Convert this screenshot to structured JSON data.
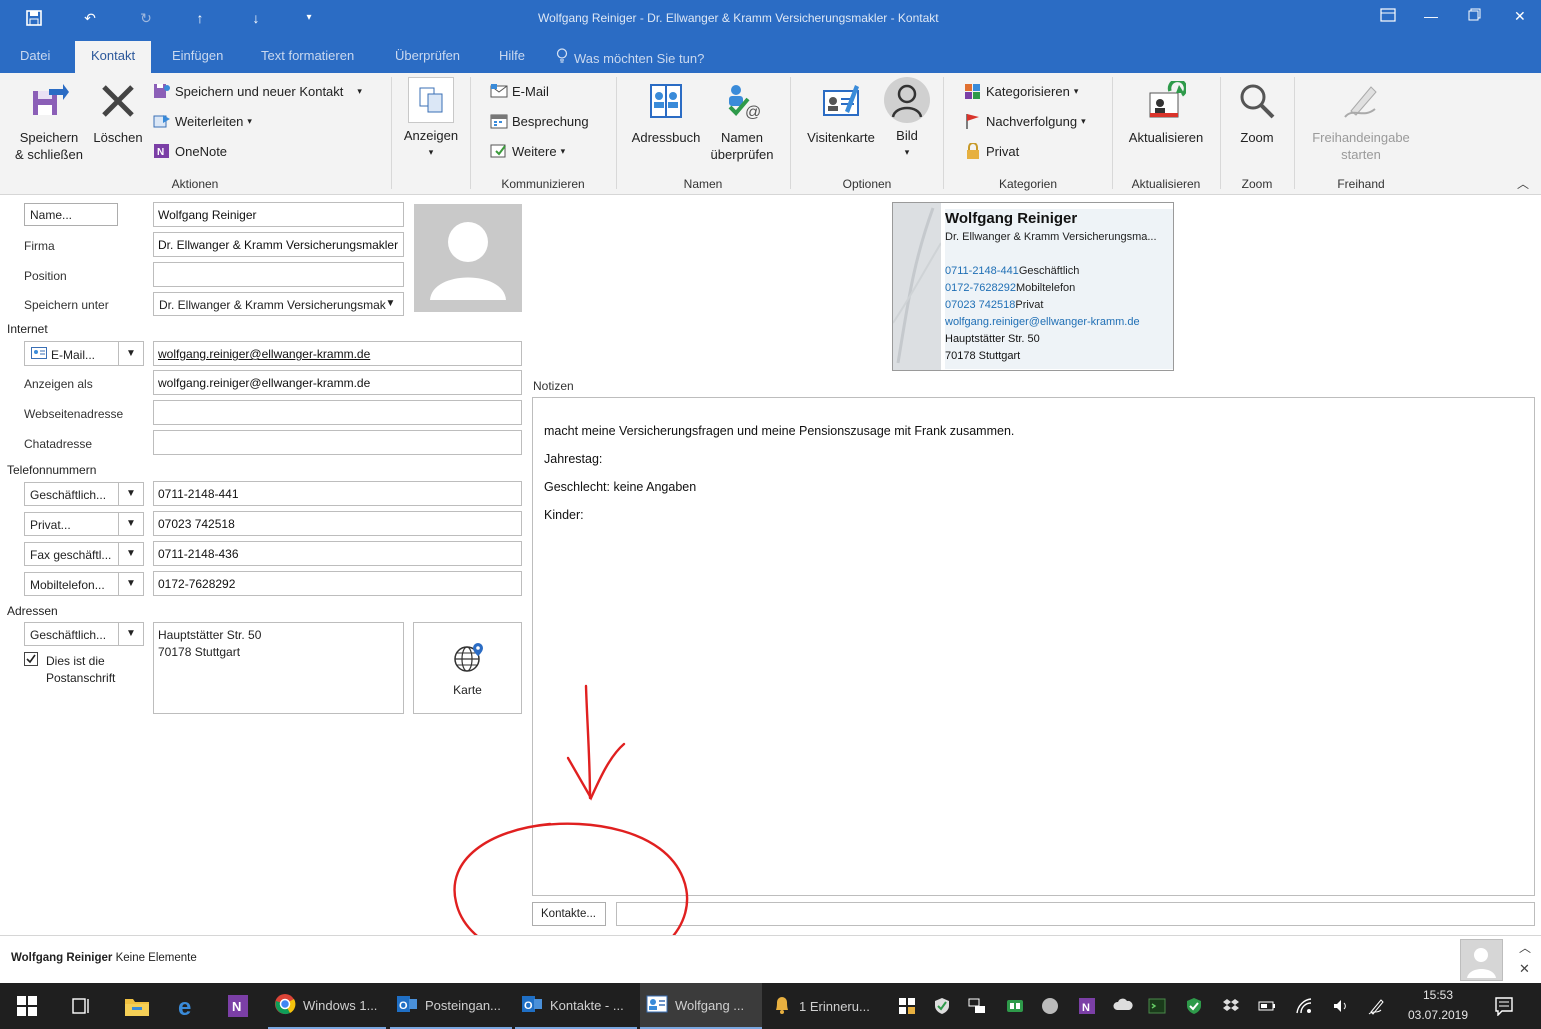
{
  "window": {
    "title": "Wolfgang Reiniger - Dr. Ellwanger & Kramm  Versicherungsmakler  -  Kontakt",
    "quick_access": [
      "save-icon",
      "undo-icon",
      "redo-icon",
      "up-arrow-icon",
      "down-arrow-icon",
      "customize-icon"
    ],
    "controls": [
      "restore-ribbon-icon",
      "minimize-icon",
      "maximize-icon",
      "close-icon"
    ]
  },
  "tabs": {
    "file": "Datei",
    "contact": "Kontakt",
    "insert": "Einfügen",
    "format": "Text formatieren",
    "review": "Überprüfen",
    "help": "Hilfe",
    "tell_me": "Was möchten Sie tun?"
  },
  "ribbon": {
    "actions": {
      "label": "Aktionen",
      "save_close_1": "Speichern",
      "save_close_2": "& schließen",
      "delete": "Löschen",
      "save_new": "Speichern und neuer Kontakt",
      "forward": "Weiterleiten",
      "onenote": "OneNote"
    },
    "show": {
      "label": "Anzeigen"
    },
    "communicate": {
      "label": "Kommunizieren",
      "email": "E-Mail",
      "meeting": "Besprechung",
      "more": "Weitere"
    },
    "names": {
      "label": "Namen",
      "address_book": "Adressbuch",
      "check_names_1": "Namen",
      "check_names_2": "überprüfen"
    },
    "options": {
      "label": "Optionen",
      "business_card": "Visitenkarte",
      "picture": "Bild"
    },
    "tags": {
      "label": "Kategorien",
      "categorize": "Kategorisieren",
      "follow_up": "Nachverfolgung",
      "private": "Privat"
    },
    "update": {
      "label": "Aktualisieren",
      "update": "Aktualisieren"
    },
    "zoom": {
      "label": "Zoom",
      "zoom": "Zoom"
    },
    "ink": {
      "label": "Freihand",
      "start_1": "Freihandeingabe",
      "start_2": "starten"
    }
  },
  "form": {
    "name_button": "Name...",
    "full_name": "Wolfgang Reiniger",
    "company_label": "Firma",
    "company": "Dr. Ellwanger & Kramm  Versicherungsmakler",
    "position_label": "Position",
    "position": "",
    "file_as_label": "Speichern unter",
    "file_as": "Dr. Ellwanger & Kramm  Versicherungsmak",
    "internet_section": "Internet",
    "email_type": "E-Mail...",
    "email": "wolfgang.reiniger@ellwanger-kramm.de",
    "display_as_label": "Anzeigen als",
    "display_as": "wolfgang.reiniger@ellwanger-kramm.de",
    "webpage_label": "Webseitenadresse",
    "webpage": "",
    "im_label": "Chatadresse",
    "im": "",
    "phones_section": "Telefonnummern",
    "phones": [
      {
        "type": "Geschäftlich...",
        "number": "0711-2148-441"
      },
      {
        "type": "Privat...",
        "number": "07023 742518"
      },
      {
        "type": "Fax geschäftl...",
        "number": "0711-2148-436"
      },
      {
        "type": "Mobiltelefon...",
        "number": "0172-7628292"
      }
    ],
    "addresses_section": "Adressen",
    "address_type": "Geschäftlich...",
    "address_lines": [
      "Hauptstätter Str. 50",
      "70178 Stuttgart"
    ],
    "mailing_address_checked": true,
    "mailing_address_1": "Dies ist die",
    "mailing_address_2": "Postanschrift",
    "map_button": "Karte"
  },
  "business_card": {
    "name": "Wolfgang Reiniger",
    "company": "Dr. Ellwanger & Kramm  Versicherungsma...",
    "phones": [
      {
        "number": "0711-2148-441",
        "label": "Geschäftlich"
      },
      {
        "number": "0172-7628292",
        "label": "Mobiltelefon"
      },
      {
        "number": "07023 742518",
        "label": "Privat"
      }
    ],
    "email": "wolfgang.reiniger@ellwanger-kramm.de",
    "street": "Hauptstätter Str. 50",
    "city": "70178 Stuttgart"
  },
  "notes": {
    "label": "Notizen",
    "lines": [
      "macht meine Versicherungsfragen und meine Pensionszusage mit Frank zusammen.",
      "Jahrestag:",
      "Geschlecht: keine Angaben",
      "Kinder:"
    ]
  },
  "contacts_button": "Kontakte...",
  "contacts_value": "",
  "status": {
    "name": "Wolfgang Reiniger",
    "text": "Keine Elemente"
  },
  "taskbar": {
    "items": [
      {
        "icon": "chrome-icon",
        "label": "Windows 1..."
      },
      {
        "icon": "outlook-icon",
        "label": "Posteingan..."
      },
      {
        "icon": "outlook-icon",
        "label": "Kontakte - ..."
      },
      {
        "icon": "contact-icon",
        "label": "Wolfgang ..."
      },
      {
        "icon": "bell-icon",
        "label": "1 Erinneru..."
      }
    ],
    "time": "15:53",
    "date": "03.07.2019"
  },
  "colors": {
    "accent": "#2b6cc4",
    "annotation": "#e02020",
    "link": "#1f6fb5"
  }
}
